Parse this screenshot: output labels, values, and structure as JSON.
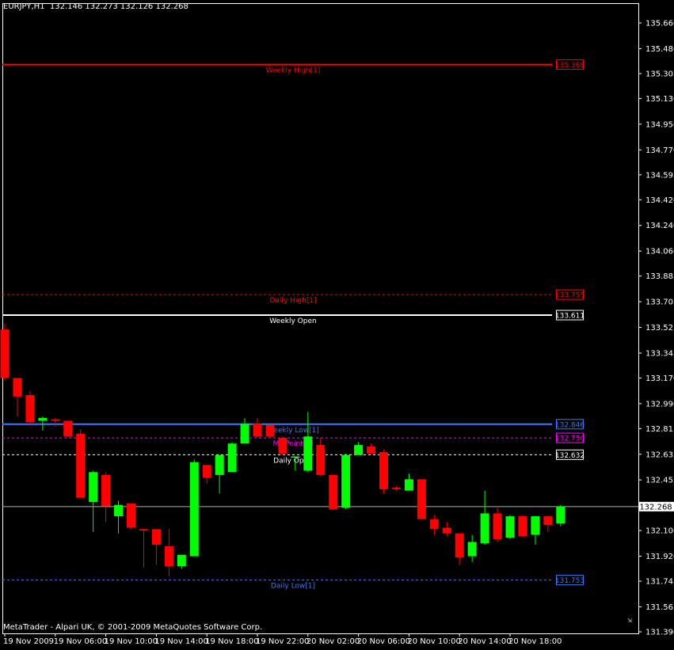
{
  "window": {
    "symbol_info": "EURJPY,H1  132.146 132.273 132.126 132.268",
    "copyright": "MetaTrader - Alpari UK, © 2001-2009 MetaQuotes Software Corp."
  },
  "colors": {
    "background": "#000000",
    "frame": "#ffffff",
    "bull": "#00ff00",
    "bear": "#ff0000",
    "weekly_high": "#ff0000",
    "daily_high": "#ff0000",
    "weekly_open": "#ffffff",
    "weekly_low": "#3c78ff",
    "midpoint": "#ff00ff",
    "daily_open": "#ffffff",
    "daily_low": "#3c78ff",
    "bid": "#b0b0b0"
  },
  "chart_data": {
    "type": "candlestick",
    "symbol": "EURJPY",
    "timeframe": "H1",
    "ylim": [
      131.39,
      135.75
    ],
    "yticks": [
      "135.660",
      "135.480",
      "135.305",
      "135.130",
      "134.950",
      "134.770",
      "134.595",
      "134.420",
      "134.240",
      "134.060",
      "133.885",
      "133.705",
      "133.525",
      "133.345",
      "133.170",
      "132.990",
      "132.815",
      "132.635",
      "132.455",
      "132.280",
      "132.100",
      "131.920",
      "131.745",
      "131.565",
      "131.390"
    ],
    "xticks": [
      {
        "index": 0,
        "label": "19 Nov 2009"
      },
      {
        "index": 4,
        "label": "19 Nov 06:00"
      },
      {
        "index": 8,
        "label": "19 Nov 10:00"
      },
      {
        "index": 12,
        "label": "19 Nov 14:00"
      },
      {
        "index": 16,
        "label": "19 Nov 18:00"
      },
      {
        "index": 20,
        "label": "19 Nov 22:00"
      },
      {
        "index": 24,
        "label": "20 Nov 02:00"
      },
      {
        "index": 28,
        "label": "20 Nov 06:00"
      },
      {
        "index": 32,
        "label": "20 Nov 10:00"
      },
      {
        "index": 36,
        "label": "20 Nov 14:00"
      },
      {
        "index": 40,
        "label": "20 Nov 18:00"
      }
    ],
    "candles": [
      {
        "o": 133.51,
        "h": 133.55,
        "l": 133.15,
        "c": 133.17
      },
      {
        "o": 133.17,
        "h": 133.17,
        "l": 132.9,
        "c": 133.04
      },
      {
        "o": 133.05,
        "h": 133.08,
        "l": 132.85,
        "c": 132.86
      },
      {
        "o": 132.87,
        "h": 132.9,
        "l": 132.8,
        "c": 132.89
      },
      {
        "o": 132.88,
        "h": 132.89,
        "l": 132.83,
        "c": 132.87
      },
      {
        "o": 132.87,
        "h": 132.87,
        "l": 132.78,
        "c": 132.76
      },
      {
        "o": 132.78,
        "h": 132.81,
        "l": 132.33,
        "c": 132.33
      },
      {
        "o": 132.3,
        "h": 132.52,
        "l": 132.09,
        "c": 132.51
      },
      {
        "o": 132.49,
        "h": 132.51,
        "l": 132.16,
        "c": 132.27
      },
      {
        "o": 132.2,
        "h": 132.31,
        "l": 132.08,
        "c": 132.28
      },
      {
        "o": 132.29,
        "h": 132.29,
        "l": 132.11,
        "c": 132.12
      },
      {
        "o": 132.11,
        "h": 132.11,
        "l": 131.84,
        "c": 132.1
      },
      {
        "o": 132.11,
        "h": 132.11,
        "l": 131.86,
        "c": 132.0
      },
      {
        "o": 131.99,
        "h": 132.11,
        "l": 131.78,
        "c": 131.85
      },
      {
        "o": 131.85,
        "h": 131.92,
        "l": 131.83,
        "c": 131.93
      },
      {
        "o": 131.92,
        "h": 132.6,
        "l": 131.92,
        "c": 132.58
      },
      {
        "o": 132.56,
        "h": 132.56,
        "l": 132.43,
        "c": 132.47
      },
      {
        "o": 132.49,
        "h": 132.62,
        "l": 132.36,
        "c": 132.63
      },
      {
        "o": 132.51,
        "h": 132.72,
        "l": 132.51,
        "c": 132.71
      },
      {
        "o": 132.71,
        "h": 132.89,
        "l": 132.71,
        "c": 132.85
      },
      {
        "o": 132.85,
        "h": 132.89,
        "l": 132.76,
        "c": 132.76
      },
      {
        "o": 132.84,
        "h": 132.84,
        "l": 132.75,
        "c": 132.76
      },
      {
        "o": 132.75,
        "h": 132.76,
        "l": 132.63,
        "c": 132.64
      },
      {
        "o": 132.62,
        "h": 132.62,
        "l": 132.52,
        "c": 132.62
      },
      {
        "o": 132.52,
        "h": 132.93,
        "l": 132.51,
        "c": 132.76
      },
      {
        "o": 132.7,
        "h": 132.75,
        "l": 132.48,
        "c": 132.49
      },
      {
        "o": 132.49,
        "h": 132.49,
        "l": 132.25,
        "c": 132.25
      },
      {
        "o": 132.26,
        "h": 132.64,
        "l": 132.25,
        "c": 132.63
      },
      {
        "o": 132.63,
        "h": 132.72,
        "l": 132.63,
        "c": 132.7
      },
      {
        "o": 132.69,
        "h": 132.71,
        "l": 132.64,
        "c": 132.64
      },
      {
        "o": 132.65,
        "h": 132.67,
        "l": 132.36,
        "c": 132.39
      },
      {
        "o": 132.4,
        "h": 132.41,
        "l": 132.38,
        "c": 132.39
      },
      {
        "o": 132.38,
        "h": 132.5,
        "l": 132.38,
        "c": 132.46
      },
      {
        "o": 132.46,
        "h": 132.46,
        "l": 132.18,
        "c": 132.18
      },
      {
        "o": 132.18,
        "h": 132.21,
        "l": 132.07,
        "c": 132.11
      },
      {
        "o": 132.12,
        "h": 132.16,
        "l": 132.06,
        "c": 132.08
      },
      {
        "o": 132.08,
        "h": 132.08,
        "l": 131.86,
        "c": 131.91
      },
      {
        "o": 131.92,
        "h": 132.07,
        "l": 131.88,
        "c": 132.02
      },
      {
        "o": 132.01,
        "h": 132.38,
        "l": 132.0,
        "c": 132.22
      },
      {
        "o": 132.22,
        "h": 132.26,
        "l": 132.02,
        "c": 132.04
      },
      {
        "o": 132.05,
        "h": 132.21,
        "l": 132.04,
        "c": 132.2
      },
      {
        "o": 132.2,
        "h": 132.21,
        "l": 132.05,
        "c": 132.06
      },
      {
        "o": 132.07,
        "h": 132.2,
        "l": 132.0,
        "c": 132.2
      },
      {
        "o": 132.2,
        "h": 132.2,
        "l": 132.09,
        "c": 132.14
      },
      {
        "o": 132.15,
        "h": 132.28,
        "l": 132.13,
        "c": 132.27
      }
    ],
    "levels": [
      {
        "key": "weekly_high",
        "label": "Weekly High[1]",
        "price": 135.368,
        "price_label": "135.368",
        "style": "solid",
        "color": "#ff0000"
      },
      {
        "key": "daily_high",
        "label": "Daily High[1]",
        "price": 133.755,
        "price_label": "133.755",
        "style": "dashed",
        "color": "#ff0000"
      },
      {
        "key": "weekly_open",
        "label": "Weekly Open",
        "price": 133.611,
        "price_label": "133.611",
        "style": "solid",
        "color": "#ffffff"
      },
      {
        "key": "weekly_low",
        "label": "Weekly Low[1]",
        "price": 132.846,
        "price_label": "132.846",
        "style": "solid",
        "color": "#3c78ff"
      },
      {
        "key": "midpoint",
        "label": "MidPoint[1]",
        "price": 132.75,
        "price_label": "132.750",
        "style": "dashed",
        "color": "#ff00ff"
      },
      {
        "key": "daily_open",
        "label": "Daily Open",
        "price": 132.632,
        "price_label": "132.632",
        "style": "dashed",
        "color": "#ffffff"
      },
      {
        "key": "daily_low",
        "label": "Daily Low[1]",
        "price": 131.753,
        "price_label": "131.753",
        "style": "dashed",
        "color": "#3c78ff"
      }
    ],
    "bid": {
      "price": 132.268,
      "price_label": "132.268"
    }
  }
}
